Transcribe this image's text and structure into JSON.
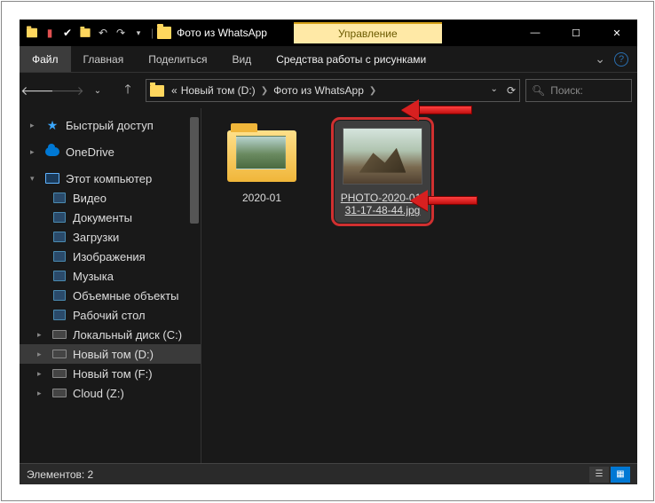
{
  "titlebar": {
    "window_title": "Фото из WhatsApp",
    "manage_label": "Управление"
  },
  "ribbon": {
    "file": "Файл",
    "home": "Главная",
    "share": "Поделиться",
    "view": "Вид",
    "context_tab": "Средства работы с рисунками"
  },
  "address": {
    "prefix": "«",
    "crumb1": "Новый том (D:)",
    "crumb2": "Фото из WhatsApp",
    "search_placeholder": "Поиск:"
  },
  "sidebar": {
    "quick": "Быстрый доступ",
    "onedrive": "OneDrive",
    "thispc": "Этот компьютер",
    "children": [
      "Видео",
      "Документы",
      "Загрузки",
      "Изображения",
      "Музыка",
      "Объемные объекты",
      "Рабочий стол",
      "Локальный диск (C:)",
      "Новый том (D:)",
      "Новый том (F:)",
      "Cloud (Z:)"
    ]
  },
  "content": {
    "items": [
      {
        "name": "2020-01",
        "type": "folder"
      },
      {
        "name": "PHOTO-2020-01-31-17-48-44.jpg",
        "type": "image",
        "selected": true
      }
    ]
  },
  "statusbar": {
    "count_label": "Элементов: 2"
  }
}
